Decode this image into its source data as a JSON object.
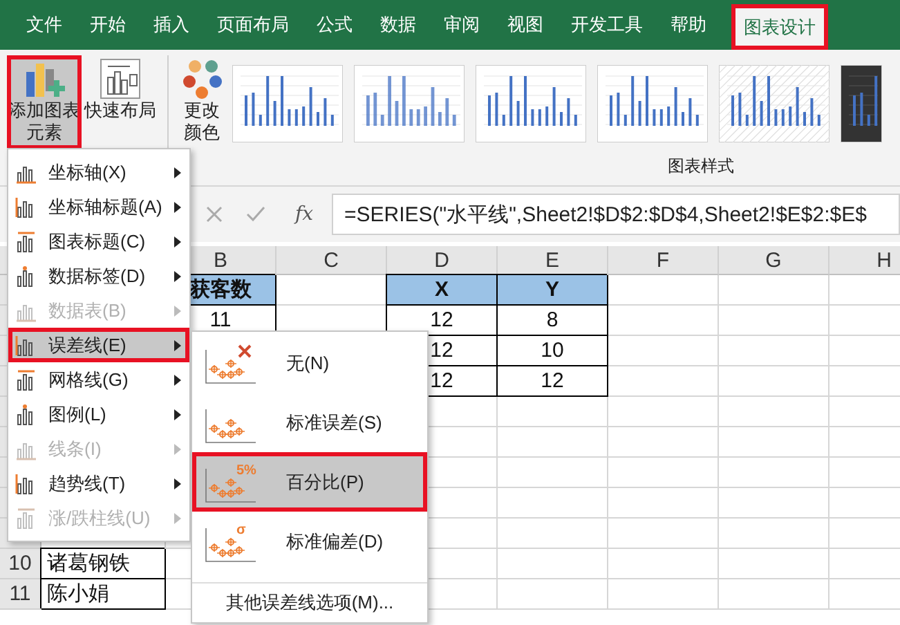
{
  "tabs": [
    {
      "label": "文件",
      "selected": false,
      "highlighted": false
    },
    {
      "label": "开始",
      "selected": false,
      "highlighted": false
    },
    {
      "label": "插入",
      "selected": false,
      "highlighted": false
    },
    {
      "label": "页面布局",
      "selected": false,
      "highlighted": false
    },
    {
      "label": "公式",
      "selected": false,
      "highlighted": false
    },
    {
      "label": "数据",
      "selected": false,
      "highlighted": false
    },
    {
      "label": "审阅",
      "selected": false,
      "highlighted": false
    },
    {
      "label": "视图",
      "selected": false,
      "highlighted": false
    },
    {
      "label": "开发工具",
      "selected": false,
      "highlighted": false
    },
    {
      "label": "帮助",
      "selected": false,
      "highlighted": false
    },
    {
      "label": "图表设计",
      "selected": true,
      "highlighted": true
    }
  ],
  "ribbon": {
    "buttons": [
      {
        "kind": "add-element",
        "label": "添加图表元素",
        "pressed": true,
        "highlighted": true
      },
      {
        "kind": "quick-layout",
        "label": "快速布局",
        "pressed": false,
        "highlighted": false
      },
      {
        "kind": "change-colors",
        "label": "更改颜色",
        "pressed": false,
        "highlighted": false
      }
    ],
    "gallery": [
      {
        "kind": "light"
      },
      {
        "kind": "dotted"
      },
      {
        "kind": "light"
      },
      {
        "kind": "light"
      },
      {
        "kind": "hatched"
      },
      {
        "kind": "dark"
      }
    ],
    "group_label": "图表样式"
  },
  "formula_bar": {
    "function_label": "fx",
    "formula": "=SERIES(\"水平线\",Sheet2!$D$2:$D$4,Sheet2!$E$2:$E$"
  },
  "sheet": {
    "column_headers": [
      "B",
      "C",
      "D",
      "E",
      "F",
      "G",
      "H"
    ],
    "top_rows": [
      {
        "header": true,
        "cells": {
          "B": "获客数",
          "D": "X",
          "E": "Y"
        }
      },
      {
        "header": false,
        "cells": {
          "B": "11",
          "D": "12",
          "E": "8"
        }
      },
      {
        "header": false,
        "cells": {
          "D": "12",
          "E": "10"
        }
      },
      {
        "header": false,
        "cells": {
          "D": "12",
          "E": "12"
        }
      }
    ],
    "bottom_rows": [
      {
        "number": "10",
        "cells": {
          "A": "诸葛钢铁"
        }
      },
      {
        "number": "11",
        "cells": {
          "A": "陈小娟"
        }
      }
    ]
  },
  "menu": {
    "items": [
      {
        "label": "坐标轴(X)",
        "disabled": false,
        "selected": false,
        "highlighted": false
      },
      {
        "label": "坐标轴标题(A)",
        "disabled": false,
        "selected": false,
        "highlighted": false
      },
      {
        "label": "图表标题(C)",
        "disabled": false,
        "selected": false,
        "highlighted": false
      },
      {
        "label": "数据标签(D)",
        "disabled": false,
        "selected": false,
        "highlighted": false
      },
      {
        "label": "数据表(B)",
        "disabled": true,
        "selected": false,
        "highlighted": false
      },
      {
        "label": "误差线(E)",
        "disabled": false,
        "selected": true,
        "highlighted": true
      },
      {
        "label": "网格线(G)",
        "disabled": false,
        "selected": false,
        "highlighted": false
      },
      {
        "label": "图例(L)",
        "disabled": false,
        "selected": false,
        "highlighted": false
      },
      {
        "label": "线条(I)",
        "disabled": true,
        "selected": false,
        "highlighted": false
      },
      {
        "label": "趋势线(T)",
        "disabled": false,
        "selected": false,
        "highlighted": false
      },
      {
        "label": "涨/跌柱线(U)",
        "disabled": true,
        "selected": false,
        "highlighted": false
      }
    ]
  },
  "submenu": {
    "items": [
      {
        "label": "无(N)",
        "selected": false,
        "highlighted": false,
        "kind": "none"
      },
      {
        "label": "标准误差(S)",
        "selected": false,
        "highlighted": false,
        "kind": "plain"
      },
      {
        "label": "百分比(P)",
        "icon_text": "5%",
        "selected": true,
        "highlighted": true,
        "kind": "text"
      },
      {
        "label": "标准偏差(D)",
        "icon_text": "σ",
        "selected": false,
        "highlighted": false,
        "kind": "text"
      }
    ],
    "more": "其他误差线选项(M)..."
  }
}
